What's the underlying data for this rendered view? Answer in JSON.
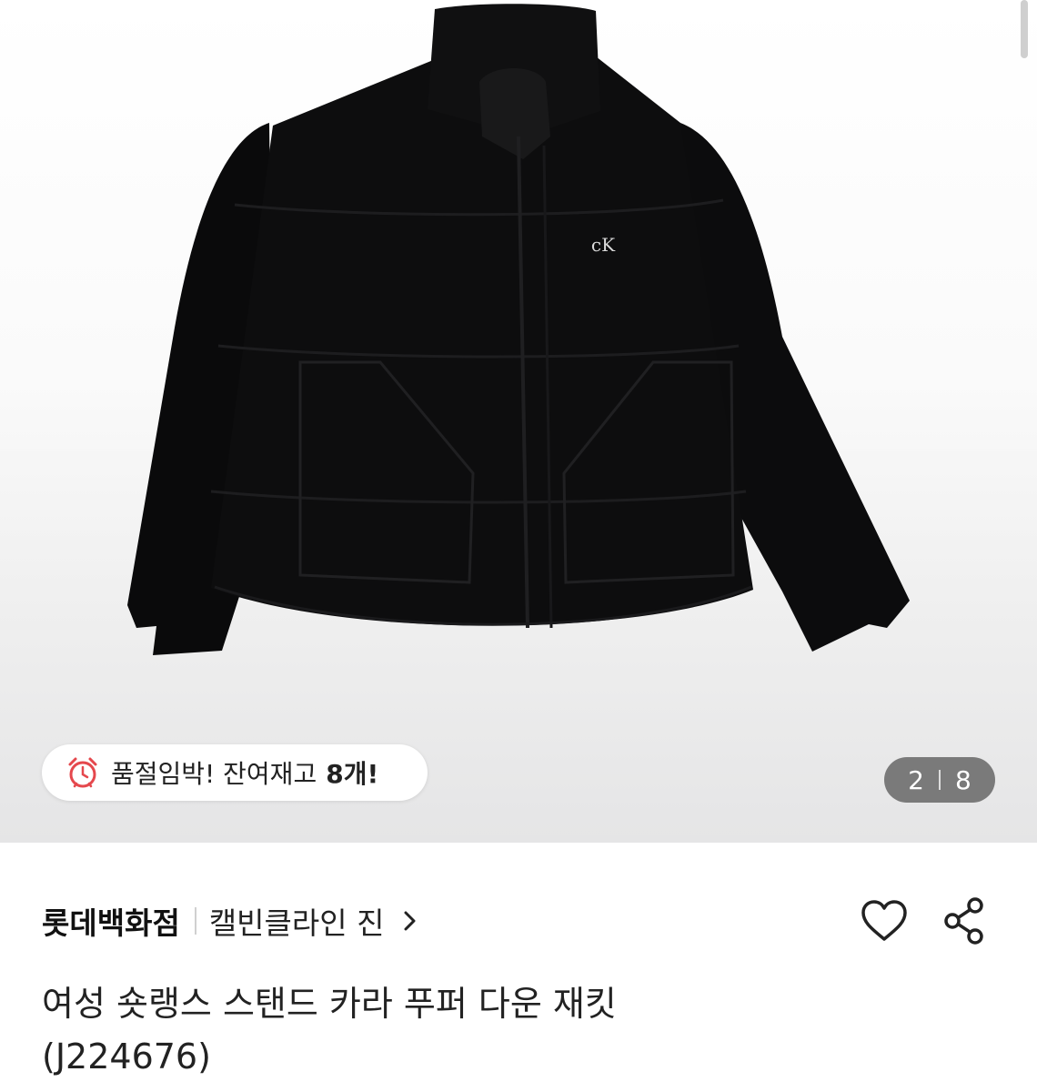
{
  "gallery": {
    "logo_text": "cK",
    "stock_notice": "품절임박! 잔여재고",
    "stock_count": "8개!",
    "current_page": "2",
    "total_pages": "8",
    "colors": {
      "counter_bg": "#7a7a7a",
      "clock": "#e5484d"
    }
  },
  "product": {
    "store": "롯데백화점",
    "brand": "캘빈클라인 진",
    "title_line1": "여성 숏랭스 스탠드 카라 푸퍼 다운 재킷",
    "title_line2": "(J224676)"
  },
  "icons": {
    "stock": "alarm-clock-icon",
    "brand_link": "chevron-right-icon",
    "like": "heart-outline-icon",
    "share": "share-icon"
  }
}
